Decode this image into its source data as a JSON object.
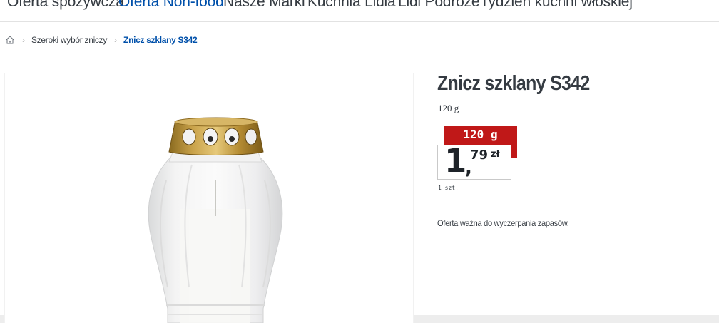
{
  "topnav": {
    "items": [
      {
        "label": "Oferta spożywcza",
        "active": false
      },
      {
        "label": "Oferta Non-food",
        "active": true
      },
      {
        "label": "Nasze Marki",
        "active": false
      },
      {
        "label": "Kuchnia Lidla",
        "active": false
      },
      {
        "label": "Lidl Podróże",
        "active": false
      },
      {
        "label": "Tydzień kuchni włoskiej",
        "active": false
      }
    ]
  },
  "breadcrumb": {
    "home_icon": "home-icon",
    "items": [
      "Szeroki wybór zniczy",
      "Znicz szklany S342"
    ]
  },
  "product": {
    "title": "Znicz szklany S342",
    "weight": "120 g",
    "image_alt_icon": "glass-grave-candle",
    "price": {
      "tag_label": "120 g",
      "integer": "1",
      "comma": ",",
      "cents": "79",
      "currency": "zł",
      "unit": "1 szt."
    },
    "offer_note": "Oferta ważna do wyczerpania zapasów."
  },
  "colors": {
    "accent": "#0050aa",
    "price_red": "#c01818",
    "text": "#353b42"
  }
}
